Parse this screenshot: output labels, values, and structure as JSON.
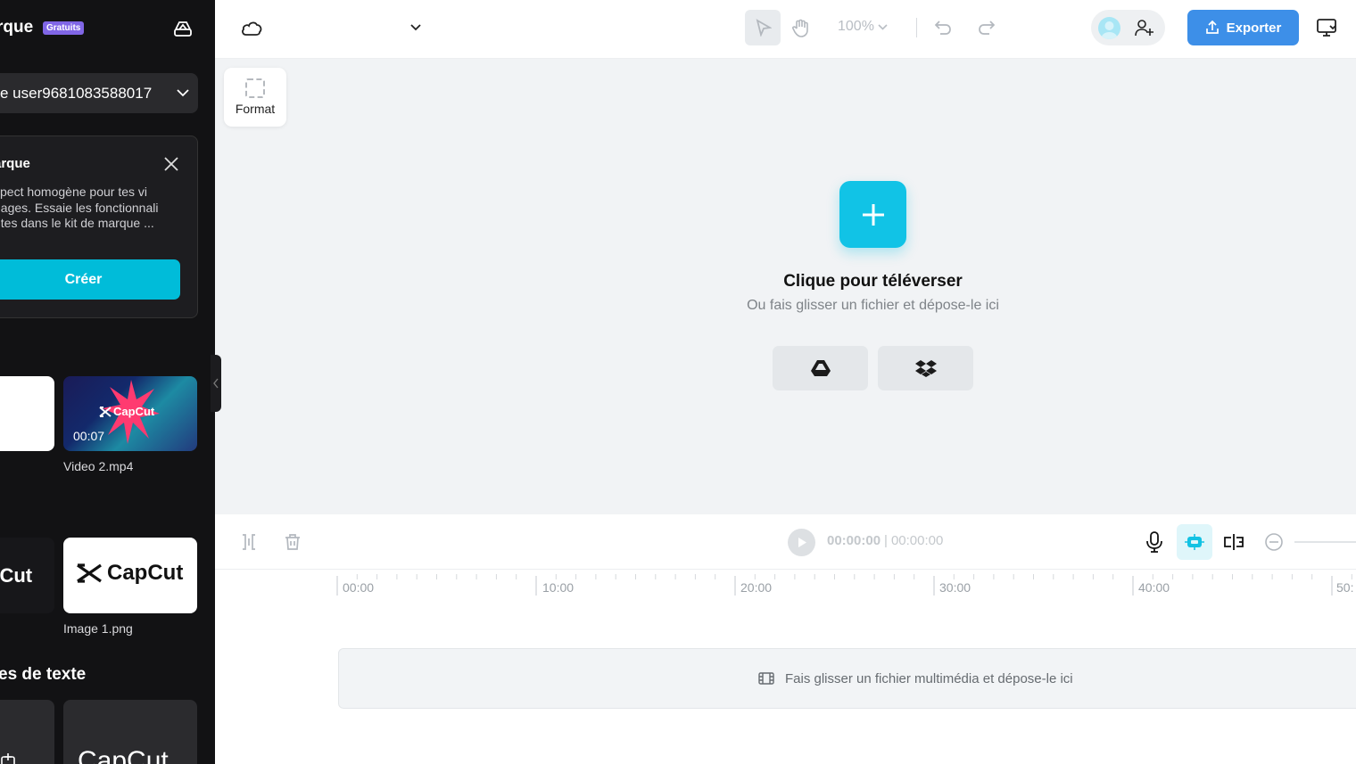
{
  "sidebar": {
    "brand_title": "rque",
    "brand_badge": "Gratuits",
    "workspace_name": "e user9681083588017",
    "promo": {
      "title": "arque",
      "body_lines": [
        "spect homogène pour tes vi",
        "nages. Essaie les fonctionnali",
        "ntes dans le kit de marque ..."
      ],
      "button": "Créer"
    },
    "media": [
      {
        "name": "Video 2.mp4",
        "duration": "00:07",
        "thumb_text": "CapCut"
      },
      {
        "name": "Image 1.png",
        "thumb_text": "CapCut"
      }
    ],
    "dark_thumb_text": "pCut",
    "text_section_title": "es de texte",
    "text_thumb_text": "CapCut"
  },
  "topbar": {
    "zoom": "100%",
    "export_label": "Exporter"
  },
  "canvas": {
    "format_label": "Format",
    "upload_title": "Clique pour téléverser",
    "upload_subtitle": "Ou fais glisser un fichier et dépose-le ici"
  },
  "timeline": {
    "current_time": "00:00:00",
    "separator": "|",
    "total_time": "00:00:00",
    "ruler": [
      "00:00",
      "10:00",
      "20:00",
      "30:00",
      "40:00",
      "50:"
    ],
    "drop_hint": "Fais glisser un fichier multimédia et dépose-le ici"
  },
  "colors": {
    "accent": "#11c3e6",
    "export": "#3d8fe8",
    "sidebar_bg": "#121214",
    "badge": "#8066e6"
  }
}
